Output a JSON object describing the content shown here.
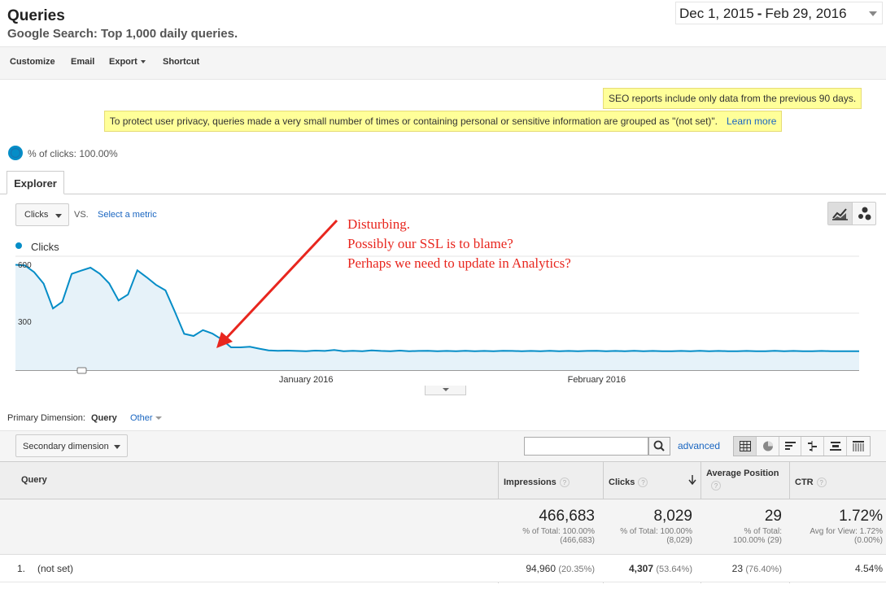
{
  "header": {
    "title": "Queries",
    "subtitle": "Google Search: Top 1,000 daily queries.",
    "date_start": "Dec 1, 2015",
    "date_sep": "-",
    "date_end": "Feb 29, 2016"
  },
  "toolbar": {
    "customize": "Customize",
    "email": "Email",
    "export": "Export",
    "shortcut": "Shortcut"
  },
  "notices": {
    "seo": "SEO reports include only data from the previous 90 days.",
    "privacy": "To protect user privacy, queries made a very small number of times or containing personal or sensitive information are grouped as \"(not set)\".",
    "learn_more": "Learn more"
  },
  "sample": {
    "text": "% of clicks: 100.00%"
  },
  "tabs": {
    "explorer": "Explorer"
  },
  "chart_controls": {
    "metric": "Clicks",
    "vs": "VS.",
    "select_metric": "Select a metric"
  },
  "chart_data": {
    "type": "area",
    "series": [
      {
        "name": "Clicks",
        "values": [
          555,
          552,
          516,
          456,
          325,
          360,
          507,
          524,
          540,
          508,
          457,
          367,
          398,
          526,
          489,
          449,
          420,
          308,
          191,
          180,
          211,
          193,
          162,
          120,
          120,
          123,
          113,
          104,
          102,
          103,
          101,
          100,
          103,
          101,
          106,
          100,
          102,
          100,
          104,
          101,
          100,
          103,
          100,
          101,
          102,
          100,
          101,
          100,
          102,
          100,
          101,
          100,
          102,
          101,
          100,
          101,
          100,
          102,
          100,
          101,
          100,
          101,
          102,
          100,
          101,
          100,
          102,
          100,
          101,
          100,
          100,
          101,
          100,
          102,
          100,
          101,
          100,
          100,
          101,
          100,
          100,
          102,
          100,
          101,
          100,
          100,
          101,
          100,
          100,
          100,
          100
        ]
      }
    ],
    "ylim": [
      0,
      600
    ],
    "yticks": [
      300,
      600
    ],
    "xticks": [
      "January 2016",
      "February 2016"
    ],
    "legend": "top-left",
    "color": "#058dc7",
    "fill": "#e6f2f9"
  },
  "annotation": {
    "line1": "Disturbing.",
    "line2": "Possibly our SSL is to blame?",
    "line3": "Perhaps we need to update in Analytics?",
    "color": "#e8261e"
  },
  "dimension": {
    "label": "Primary Dimension:",
    "query": "Query",
    "other": "Other",
    "secondary": "Secondary dimension",
    "advanced": "advanced"
  },
  "table": {
    "headers": {
      "query": "Query",
      "impressions": "Impressions",
      "clicks": "Clicks",
      "avg_position": "Average Position",
      "ctr": "CTR"
    },
    "totals": {
      "impressions": "466,683",
      "impressions_sub1": "% of Total: 100.00%",
      "impressions_sub2": "(466,683)",
      "clicks": "8,029",
      "clicks_sub1": "% of Total: 100.00%",
      "clicks_sub2": "(8,029)",
      "avg_position": "29",
      "avg_position_sub1": "% of Total:",
      "avg_position_sub2": "100.00% (29)",
      "ctr": "1.72%",
      "ctr_sub1": "Avg for View: 1.72%",
      "ctr_sub2": "(0.00%)"
    },
    "rows": [
      {
        "index": "1.",
        "query": "(not set)",
        "impressions": "94,960",
        "impressions_pct": "(20.35%)",
        "clicks": "4,307",
        "clicks_pct": "(53.64%)",
        "avg_position": "23",
        "avg_position_pct": "(76.40%)",
        "ctr": "4.54%"
      }
    ]
  }
}
